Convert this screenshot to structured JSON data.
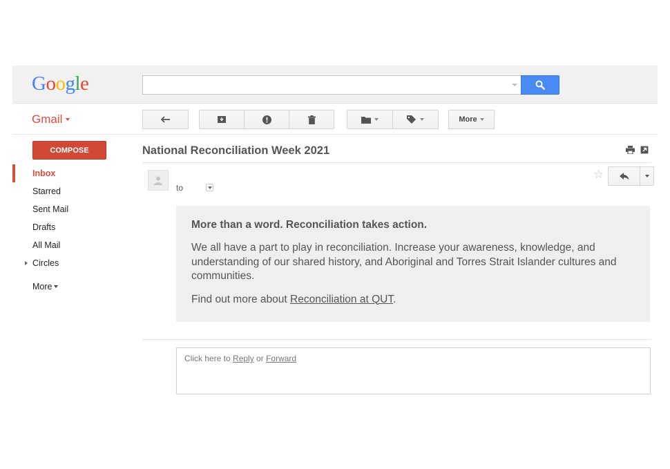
{
  "header": {
    "logo_letters": [
      {
        "ch": "G",
        "color": "#4285f4"
      },
      {
        "ch": "o",
        "color": "#ea4335"
      },
      {
        "ch": "o",
        "color": "#fbbc05"
      },
      {
        "ch": "g",
        "color": "#4285f4"
      },
      {
        "ch": "l",
        "color": "#34a853"
      },
      {
        "ch": "e",
        "color": "#ea4335"
      }
    ],
    "search": {
      "value": "",
      "placeholder": ""
    }
  },
  "toolbar": {
    "app_label": "Gmail",
    "more_label": "More"
  },
  "sidebar": {
    "compose_label": "COMPOSE",
    "items": [
      {
        "label": "Inbox",
        "active": true
      },
      {
        "label": "Starred"
      },
      {
        "label": "Sent Mail"
      },
      {
        "label": "Drafts"
      },
      {
        "label": "All Mail"
      },
      {
        "label": "Circles"
      }
    ],
    "more_label": "More"
  },
  "message": {
    "subject": "National Reconciliation Week 2021",
    "to_label": "to",
    "heading": "More than a word. Reconciliation takes action.",
    "paragraph": "We all have a part to play in reconciliation. Increase your awareness, knowledge, and understanding of our shared history, and Aboriginal and Torres Strait Islander cultures and communities.",
    "find_out_prefix": "Find out more about ",
    "find_out_link": "Reconciliation at QUT",
    "find_out_suffix": "."
  },
  "reply_box": {
    "prefix": "Click here to ",
    "reply_link": "Reply",
    "middle": " or ",
    "forward_link": "Forward"
  },
  "colors": {
    "brand_red": "#dd4b39",
    "compose_red": "#d14836",
    "search_blue": "#4a8af4"
  }
}
